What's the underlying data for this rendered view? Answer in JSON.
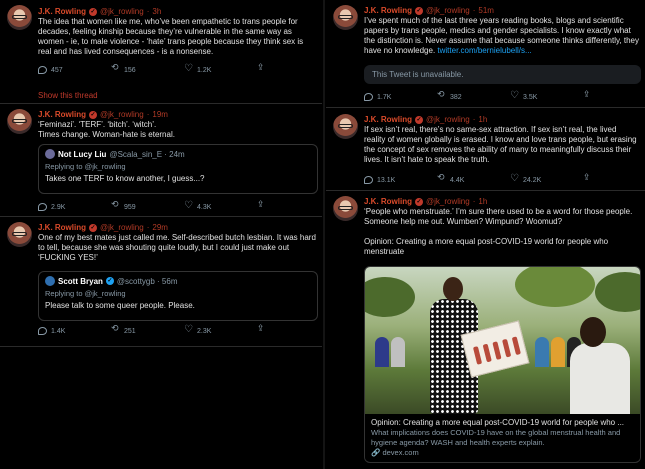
{
  "author": {
    "name": "J.K. Rowling",
    "handle": "@jk_rowling"
  },
  "left_column": [
    {
      "time": "3h",
      "text": "The idea that women like me, who’ve been empathetic to trans people for decades, feeling kinship because they’re vulnerable in the same way as women - ie, to male violence - ‘hate’ trans people because they think sex is real and has lived consequences - is a nonsense.",
      "replies": "457",
      "retweets": "156",
      "likes": "1.2K",
      "show_thread": "Show this thread"
    },
    {
      "time": "19m",
      "text": "‘Feminazi’. ‘TERF’. ‘bitch’. ‘witch’.\nTimes change. Woman-hate is eternal.",
      "quote": {
        "name": "Not Lucy Liu",
        "handle": "@Scala_sin_E · 24m",
        "replying": "Replying to @jk_rowling",
        "text": "Takes one TERF to know another, I guess...?"
      },
      "replies": "2.9K",
      "retweets": "959",
      "likes": "4.3K"
    },
    {
      "time": "29m",
      "text": "One of my best mates just called me. Self-described butch lesbian. It was hard to tell, because she was shouting quite loudly, but I could just make out ‘FUCKING YES!’",
      "quote": {
        "name": "Scott Bryan",
        "handle": "@scottygb · 56m",
        "replying": "Replying to @jk_rowling",
        "text": "Please talk to some queer people. Please."
      },
      "replies": "1.4K",
      "retweets": "251",
      "likes": "2.3K"
    }
  ],
  "right_column": [
    {
      "time": "51m",
      "text": "I’ve spent much of the last three years reading books, blogs and scientific papers by trans people, medics and gender specialists. I know exactly what the distinction is. Never assume that because someone thinks differently, they have no knowledge.",
      "link": "twitter.com/bernielubell/s...",
      "unavailable": "This Tweet is unavailable.",
      "replies": "1.7K",
      "retweets": "382",
      "likes": "3.5K"
    },
    {
      "time": "1h",
      "text": "If sex isn’t real, there’s no same-sex attraction. If sex isn’t real, the lived reality of women globally is erased. I know and love trans people, but erasing the concept of sex removes the ability of many to meaningfully discuss their lives. It isn’t hate to speak the truth.",
      "replies": "13.1K",
      "retweets": "4.4K",
      "likes": "24.2K"
    },
    {
      "time": "1h",
      "text": "‘People who menstruate.’ I’m sure there used to be a word for those people. Someone help me out. Wumben? Wimpund? Woomud?",
      "text2": "Opinion: Creating a more equal post-COVID-19 world for people who menstruate",
      "card": {
        "title": "Opinion: Creating a more equal post-COVID-19 world for people who ...",
        "desc": "What implications does COVID-19 have on the global menstrual health and hygiene agenda? WASH and health experts explain.",
        "url": "devex.com"
      }
    }
  ],
  "colors": {
    "accent": "#d94a2a",
    "link": "#1da1f2",
    "muted": "#8899a6",
    "background": "#000000"
  }
}
